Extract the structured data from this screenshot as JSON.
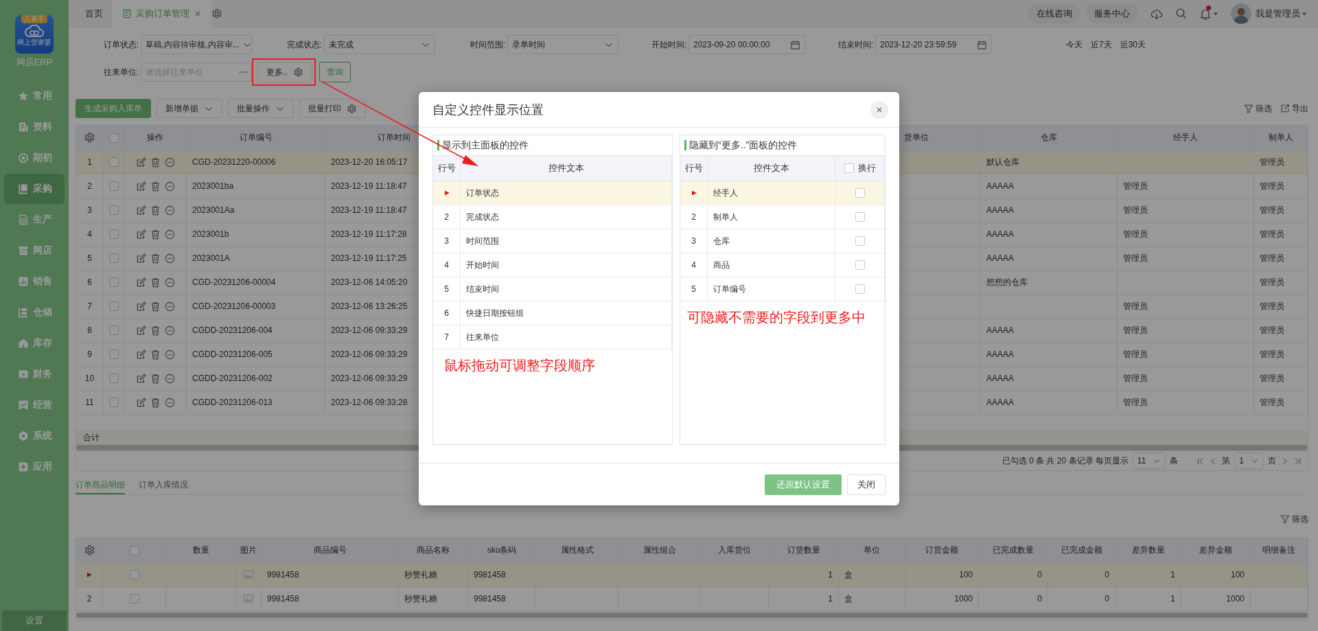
{
  "sidebar": {
    "logo_badge": "八喜手",
    "logo_text": "网上管家婆",
    "brand": "网店ERP",
    "items": [
      {
        "label": "常用",
        "selected": false
      },
      {
        "label": "资料",
        "selected": false
      },
      {
        "label": "期初",
        "selected": false
      },
      {
        "label": "采购",
        "selected": true
      },
      {
        "label": "生产",
        "selected": false
      },
      {
        "label": "网店",
        "selected": false
      },
      {
        "label": "销售",
        "selected": false
      },
      {
        "label": "仓储",
        "selected": false
      },
      {
        "label": "库存",
        "selected": false
      },
      {
        "label": "财务",
        "selected": false
      },
      {
        "label": "经营",
        "selected": false
      },
      {
        "label": "系统",
        "selected": false
      },
      {
        "label": "应用",
        "selected": false
      }
    ],
    "settings": "设置"
  },
  "tabs": [
    {
      "label": "首页",
      "selected": false,
      "closable": false
    },
    {
      "label": "采购订单管理",
      "selected": true,
      "closable": true
    }
  ],
  "header": {
    "links": [
      "在线咨询",
      "服务中心"
    ],
    "has_notification": true,
    "user": "我是管理员"
  },
  "filters": {
    "row1": [
      {
        "kind": "select",
        "label": "订单状态:",
        "value": "草稿,内容待审核,内容审..."
      },
      {
        "kind": "select",
        "label": "完成状态:",
        "value": "未完成"
      },
      {
        "kind": "select",
        "label": "时间范围:",
        "value": "录单时间"
      },
      {
        "kind": "date",
        "label": "开始时间:",
        "value": "2023-09-20 00:00:00"
      },
      {
        "kind": "date",
        "label": "结束时间:",
        "value": "2023-12-20 23:59:59"
      },
      {
        "kind": "quick",
        "options": [
          "今天",
          "近7天",
          "近30天"
        ]
      }
    ],
    "row2": [
      {
        "kind": "picker",
        "label": "往来单位:",
        "placeholder": "请选择往来单位"
      }
    ],
    "more_button": "更多..",
    "query_button": "查询"
  },
  "toolbar": {
    "buttons": [
      {
        "kind": "primary",
        "label": "生成采购入库单"
      },
      {
        "kind": "dropdown",
        "label": "新增单据"
      },
      {
        "kind": "dropdown",
        "label": "批量操作"
      },
      {
        "kind": "settings",
        "label": "批量打印"
      }
    ],
    "right": [
      "筛选",
      "导出"
    ]
  },
  "orders": {
    "header_checked": false,
    "columns": [
      "操作",
      "订单编号",
      "订单时间",
      "货单位",
      "仓库",
      "经手人",
      "制单人"
    ],
    "rows": [
      {
        "no": "1",
        "selected": true,
        "checked": false,
        "order_no": "CGD-20231220-00006",
        "order_time": "2023-12-20 16:05:17",
        "warehouse": "默认仓库",
        "maker": "管理员"
      },
      {
        "no": "2",
        "selected": false,
        "checked": false,
        "order_no": "2023001ba",
        "order_time": "2023-12-19 11:18:47",
        "warehouse": "AAAAA",
        "handler": "管理员",
        "maker": "管理员"
      },
      {
        "no": "3",
        "selected": false,
        "checked": false,
        "order_no": "2023001Aa",
        "order_time": "2023-12-19 11:18:47",
        "warehouse": "AAAAA",
        "handler": "管理员",
        "maker": "管理员"
      },
      {
        "no": "4",
        "selected": false,
        "checked": false,
        "order_no": "2023001b",
        "order_time": "2023-12-19 11:17:28",
        "warehouse": "AAAAA",
        "handler": "管理员",
        "maker": "管理员"
      },
      {
        "no": "5",
        "selected": false,
        "checked": false,
        "order_no": "2023001A",
        "order_time": "2023-12-19 11:17:25",
        "warehouse": "AAAAA",
        "handler": "管理员",
        "maker": "管理员"
      },
      {
        "no": "6",
        "selected": false,
        "checked": false,
        "order_no": "CGD-20231206-00004",
        "order_time": "2023-12-06 14:05:20",
        "warehouse": "想想的仓库",
        "maker": "管理员"
      },
      {
        "no": "7",
        "selected": false,
        "checked": false,
        "order_no": "CGD-20231206-00003",
        "order_time": "2023-12-06 13:26:25",
        "handler": "管理员",
        "maker": "管理员"
      },
      {
        "no": "8",
        "selected": false,
        "checked": false,
        "order_no": "CGDD-20231206-004",
        "order_time": "2023-12-06 09:33:29",
        "warehouse": "AAAAA",
        "handler": "管理员",
        "maker": "管理员"
      },
      {
        "no": "9",
        "selected": false,
        "checked": false,
        "order_no": "CGDD-20231206-005",
        "order_time": "2023-12-06 09:33:29",
        "warehouse": "AAAAA",
        "handler": "管理员",
        "maker": "管理员"
      },
      {
        "no": "10",
        "selected": false,
        "checked": false,
        "order_no": "CGDD-20231206-002",
        "order_time": "2023-12-06 09:33:29",
        "warehouse": "AAAAA",
        "handler": "管理员",
        "maker": "管理员"
      },
      {
        "no": "11",
        "selected": false,
        "checked": false,
        "order_no": "CGDD-20231206-013",
        "order_time": "2023-12-06 09:33:28",
        "warehouse": "AAAAA",
        "handler": "管理员",
        "maker": "管理员"
      }
    ],
    "total_label": "合计",
    "pagination": {
      "summary": "已勾选 0 条 共 20 条记录 每页显示",
      "page_size": "11",
      "size_unit": "条",
      "page_prefix": "第",
      "page": "1",
      "page_suffix": "页"
    }
  },
  "detail": {
    "tabs": [
      {
        "label": "订单商品明细",
        "selected": true
      },
      {
        "label": "订单入库情况",
        "selected": false
      }
    ],
    "filter": "筛选",
    "header_checked": false,
    "columns": [
      "数量",
      "图片",
      "商品编号",
      "商品名称",
      "sku条码",
      "属性格式",
      "属性组合",
      "入库货位",
      "订货数量",
      "单位",
      "订货金额",
      "已完成数量",
      "已完成金额",
      "差异数量",
      "差异金额",
      "明细备注"
    ],
    "rows": [
      {
        "selected": true,
        "checked": false,
        "code": "9981458",
        "name": "秒赞礼糖",
        "sku": "9981458",
        "qty": "1",
        "unit": "盒",
        "amount": "100",
        "done_qty": "0",
        "done_amount": "0",
        "diff_qty": "1",
        "diff_amount": "100"
      },
      {
        "no": "2",
        "selected": false,
        "checked": false,
        "code": "9981458",
        "name": "秒赞礼糖",
        "sku": "9981458",
        "qty": "1",
        "unit": "盒",
        "amount": "1000",
        "done_qty": "0",
        "done_amount": "0",
        "diff_qty": "1",
        "diff_amount": "1000"
      }
    ]
  },
  "dialog": {
    "title": "自定义控件显示位置",
    "left": {
      "title": "显示到主面板的控件",
      "columns": [
        "行号",
        "控件文本"
      ],
      "rows": [
        {
          "text": "订单状态",
          "selected": true
        },
        {
          "no": "2",
          "text": "完成状态",
          "selected": false
        },
        {
          "no": "3",
          "text": "时间范围",
          "selected": false
        },
        {
          "no": "4",
          "text": "开始时间",
          "selected": false
        },
        {
          "no": "5",
          "text": "结束时间",
          "selected": false
        },
        {
          "no": "6",
          "text": "快捷日期按钮组",
          "selected": false
        },
        {
          "no": "7",
          "text": "往来单位",
          "selected": false
        }
      ],
      "note": "鼠标拖动可调整字段顺序"
    },
    "right": {
      "title": "隐藏到“更多..”面板的控件",
      "columns": [
        "行号",
        "控件文本"
      ],
      "wrap": {
        "label": "换行",
        "checked": false
      },
      "rows": [
        {
          "text": "经手人",
          "selected": true,
          "checked": false
        },
        {
          "no": "2",
          "text": "制单人",
          "selected": false,
          "checked": false
        },
        {
          "no": "3",
          "text": "仓库",
          "selected": false,
          "checked": false
        },
        {
          "no": "4",
          "text": "商品",
          "selected": false,
          "checked": false
        },
        {
          "no": "5",
          "text": "订单编号",
          "selected": false,
          "checked": false
        }
      ],
      "note": "可隐藏不需要的字段到更多中"
    },
    "buttons": [
      {
        "kind": "primary",
        "label": "还原默认设置"
      },
      {
        "kind": "default",
        "label": "关闭"
      }
    ]
  }
}
